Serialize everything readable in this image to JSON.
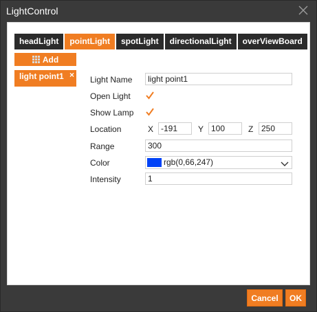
{
  "window": {
    "title": "LightControl"
  },
  "tabs": [
    {
      "label": "headLight",
      "active": false
    },
    {
      "label": "pointLight",
      "active": true
    },
    {
      "label": "spotLight",
      "active": false
    },
    {
      "label": "directionalLight",
      "active": false
    },
    {
      "label": "overViewBoard",
      "active": false
    }
  ],
  "add_button": {
    "label": "Add",
    "icon": "grid-icon"
  },
  "light_list": [
    {
      "label": "light point1",
      "close_glyph": "×"
    }
  ],
  "form": {
    "light_name": {
      "label": "Light Name",
      "value": "light point1"
    },
    "open_light": {
      "label": "Open Light",
      "checked": true
    },
    "show_lamp": {
      "label": "Show Lamp",
      "checked": true
    },
    "location": {
      "label": "Location",
      "x_label": "X",
      "x": "-191",
      "y_label": "Y",
      "y": "100",
      "z_label": "Z",
      "z": "250"
    },
    "range": {
      "label": "Range",
      "value": "300"
    },
    "color": {
      "label": "Color",
      "value": "rgb(0,66,247)",
      "swatch": "#0042f7"
    },
    "intensity": {
      "label": "Intensity",
      "value": "1"
    }
  },
  "footer": {
    "cancel_label": "Cancel",
    "ok_label": "OK"
  },
  "colors": {
    "accent": "#f07d22",
    "titlebar": "#3a3a3a",
    "tab_dark": "#2b2b2b"
  }
}
